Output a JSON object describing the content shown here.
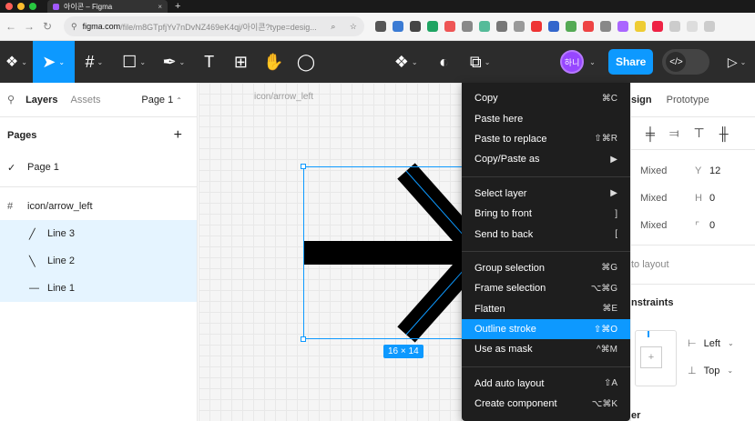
{
  "browser": {
    "tab_title": "아이콘 – Figma",
    "tab_close": "×",
    "new_tab": "+",
    "url_host": "figma.com",
    "url_path": "/file/m8GTpfjYv7nDvNZ469eK4qj/아이콘?type=desig...",
    "colors": {
      "traffic_red": "#ff5f57",
      "traffic_yellow": "#febc2e",
      "traffic_green": "#28c840"
    }
  },
  "toolbar": {
    "avatar_label": "하니",
    "share_label": "Share",
    "devmode_icon": "</>",
    "accent": "#0d99ff"
  },
  "left_panel": {
    "tab_layers": "Layers",
    "tab_assets": "Assets",
    "page_selector": "Page 1",
    "pages_heading": "Pages",
    "add_page": "+",
    "pages": [
      {
        "label": "Page 1",
        "checked": true
      }
    ],
    "frame_name": "icon/arrow_left",
    "layers": [
      {
        "label": "Line 3",
        "icon": "line-diagonal-up-icon"
      },
      {
        "label": "Line 2",
        "icon": "line-diagonal-down-icon"
      },
      {
        "label": "Line 1",
        "icon": "line-horizontal-icon"
      }
    ]
  },
  "canvas": {
    "frame_label": "icon/arrow_left",
    "size_badge": "16 × 14"
  },
  "context_menu": {
    "groups": [
      [
        {
          "label": "Copy",
          "shortcut": "⌘C"
        },
        {
          "label": "Paste here",
          "shortcut": ""
        },
        {
          "label": "Paste to replace",
          "shortcut": "⇧⌘R"
        },
        {
          "label": "Copy/Paste as",
          "shortcut": "▶"
        }
      ],
      [
        {
          "label": "Select layer",
          "shortcut": "▶"
        },
        {
          "label": "Bring to front",
          "shortcut": "]"
        },
        {
          "label": "Send to back",
          "shortcut": "["
        }
      ],
      [
        {
          "label": "Group selection",
          "shortcut": "⌘G"
        },
        {
          "label": "Frame selection",
          "shortcut": "⌥⌘G"
        },
        {
          "label": "Flatten",
          "shortcut": "⌘E"
        },
        {
          "label": "Outline stroke",
          "shortcut": "⇧⌘O",
          "highlighted": true
        },
        {
          "label": "Use as mask",
          "shortcut": "^⌘M"
        }
      ],
      [
        {
          "label": "Add auto layout",
          "shortcut": "⇧A"
        },
        {
          "label": "Create component",
          "shortcut": "⌥⌘K"
        }
      ]
    ]
  },
  "right_panel": {
    "tab_design": "sign",
    "tab_prototype": "Prototype",
    "rows": [
      {
        "v1": "Mixed",
        "lbl": "Y",
        "v2": "12"
      },
      {
        "v1": "Mixed",
        "lbl": "H",
        "v2": "0"
      },
      {
        "v1": "Mixed",
        "lbl": "⌜",
        "v2": "0"
      }
    ],
    "auto_layout": "to layout",
    "constraints_title": "nstraints",
    "constraint_h": "Left",
    "constraint_v": "Top",
    "cut_label": "er"
  }
}
